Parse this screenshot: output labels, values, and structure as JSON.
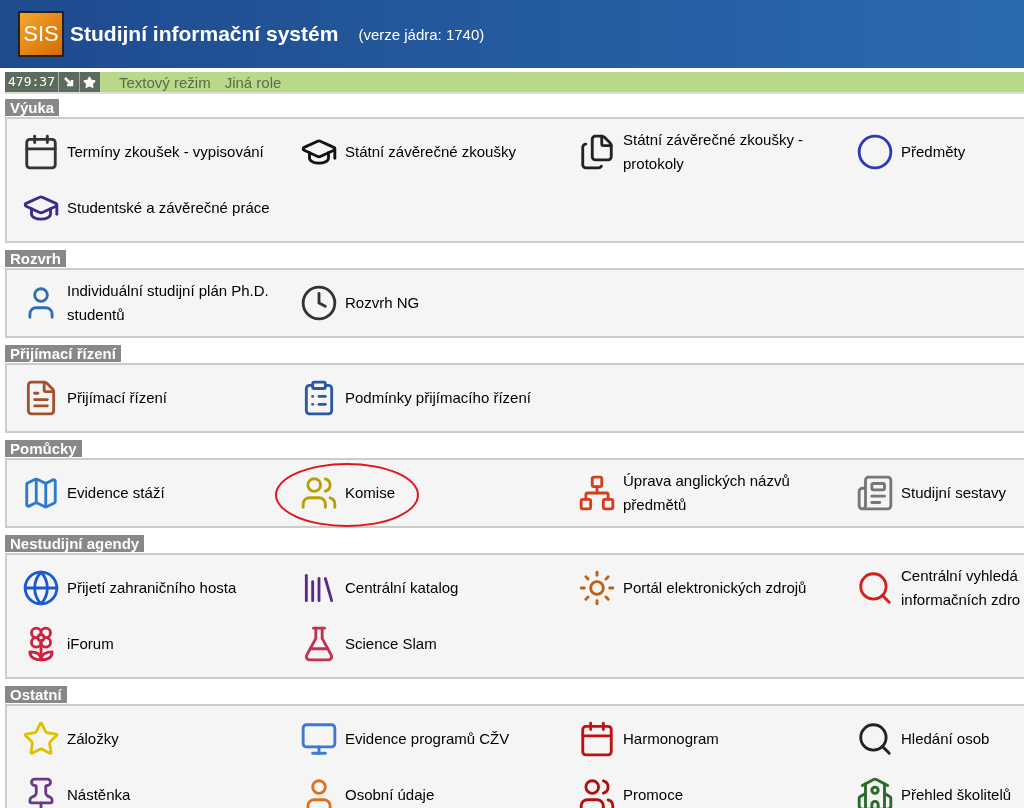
{
  "header": {
    "logo": "SIS",
    "title": "Studijní informační systém",
    "version": "(verze jádra: 1740)"
  },
  "toolbar": {
    "timer": "479:37",
    "links": [
      "Textový režim",
      "Jiná role"
    ]
  },
  "sections": [
    {
      "title": "Výuka",
      "items": [
        {
          "label": "Termíny zkoušek - vypisování"
        },
        {
          "label": "Státní závěrečné zkoušky"
        },
        {
          "label": "Státní závěrečné zkoušky - protokoly"
        },
        {
          "label": "Předměty"
        },
        {
          "label": "Studentské a závěrečné práce"
        }
      ]
    },
    {
      "title": "Rozvrh",
      "items": [
        {
          "label": "Individuální studijní plán Ph.D. studentů"
        },
        {
          "label": "Rozvrh NG"
        }
      ]
    },
    {
      "title": "Přijímací řízení",
      "items": [
        {
          "label": "Přijímací řízení"
        },
        {
          "label": "Podmínky přijímacího řízení"
        }
      ]
    },
    {
      "title": "Pomůcky",
      "items": [
        {
          "label": "Evidence stáží",
          "circled": false
        },
        {
          "label": "Komise",
          "circled": true
        },
        {
          "label": "Úprava anglických názvů předmětů",
          "circled": false
        },
        {
          "label": "Studijní sestavy",
          "circled": false
        }
      ]
    },
    {
      "title": "Nestudijní agendy",
      "items": [
        {
          "label": "Přijetí zahraničního hosta"
        },
        {
          "label": "Centrální katalog"
        },
        {
          "label": "Portál elektronických zdrojů"
        },
        {
          "label": "Centrální vyhledá informačních zdro"
        },
        {
          "label": "iForum"
        },
        {
          "label": "Science Slam"
        }
      ]
    },
    {
      "title": "Ostatní",
      "items": [
        {
          "label": "Záložky"
        },
        {
          "label": "Evidence programů CŽV"
        },
        {
          "label": "Harmonogram"
        },
        {
          "label": "Hledání osob"
        },
        {
          "label": "Nástěnka"
        },
        {
          "label": "Osobní údaje"
        },
        {
          "label": "Promoce"
        },
        {
          "label": "Přehled školitelů"
        }
      ]
    }
  ]
}
